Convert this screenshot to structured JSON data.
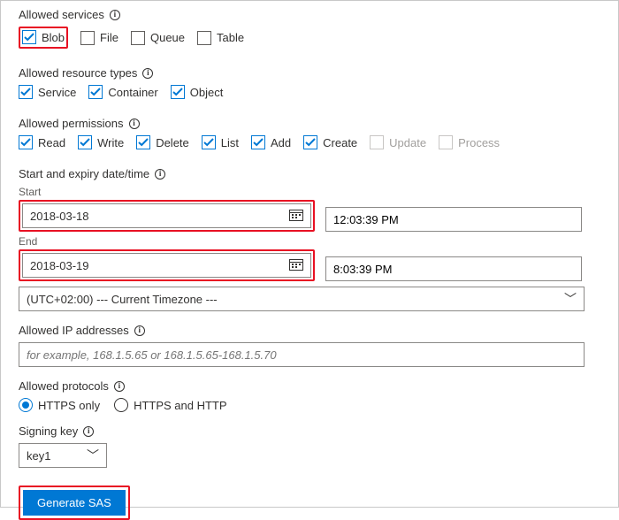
{
  "services": {
    "header": "Allowed services",
    "items": [
      {
        "label": "Blob",
        "checked": true,
        "highlight": true
      },
      {
        "label": "File",
        "checked": false,
        "highlight": false
      },
      {
        "label": "Queue",
        "checked": false,
        "highlight": false
      },
      {
        "label": "Table",
        "checked": false,
        "highlight": false
      }
    ]
  },
  "resource_types": {
    "header": "Allowed resource types",
    "items": [
      {
        "label": "Service",
        "checked": true
      },
      {
        "label": "Container",
        "checked": true
      },
      {
        "label": "Object",
        "checked": true
      }
    ]
  },
  "permissions": {
    "header": "Allowed permissions",
    "items": [
      {
        "label": "Read",
        "checked": true,
        "disabled": false
      },
      {
        "label": "Write",
        "checked": true,
        "disabled": false
      },
      {
        "label": "Delete",
        "checked": true,
        "disabled": false
      },
      {
        "label": "List",
        "checked": true,
        "disabled": false
      },
      {
        "label": "Add",
        "checked": true,
        "disabled": false
      },
      {
        "label": "Create",
        "checked": true,
        "disabled": false
      },
      {
        "label": "Update",
        "checked": false,
        "disabled": true
      },
      {
        "label": "Process",
        "checked": false,
        "disabled": true
      }
    ]
  },
  "datetime": {
    "header": "Start and expiry date/time",
    "start_label": "Start",
    "start_date": "2018-03-18",
    "start_time": "12:03:39 PM",
    "end_label": "End",
    "end_date": "2018-03-19",
    "end_time": "8:03:39 PM",
    "timezone": "(UTC+02:00) --- Current Timezone ---"
  },
  "ip": {
    "header": "Allowed IP addresses",
    "placeholder": "for example, 168.1.5.65 or 168.1.5.65-168.1.5.70"
  },
  "protocols": {
    "header": "Allowed protocols",
    "options": [
      {
        "label": "HTTPS only",
        "selected": true
      },
      {
        "label": "HTTPS and HTTP",
        "selected": false
      }
    ]
  },
  "signing_key": {
    "header": "Signing key",
    "value": "key1"
  },
  "generate_label": "Generate SAS"
}
